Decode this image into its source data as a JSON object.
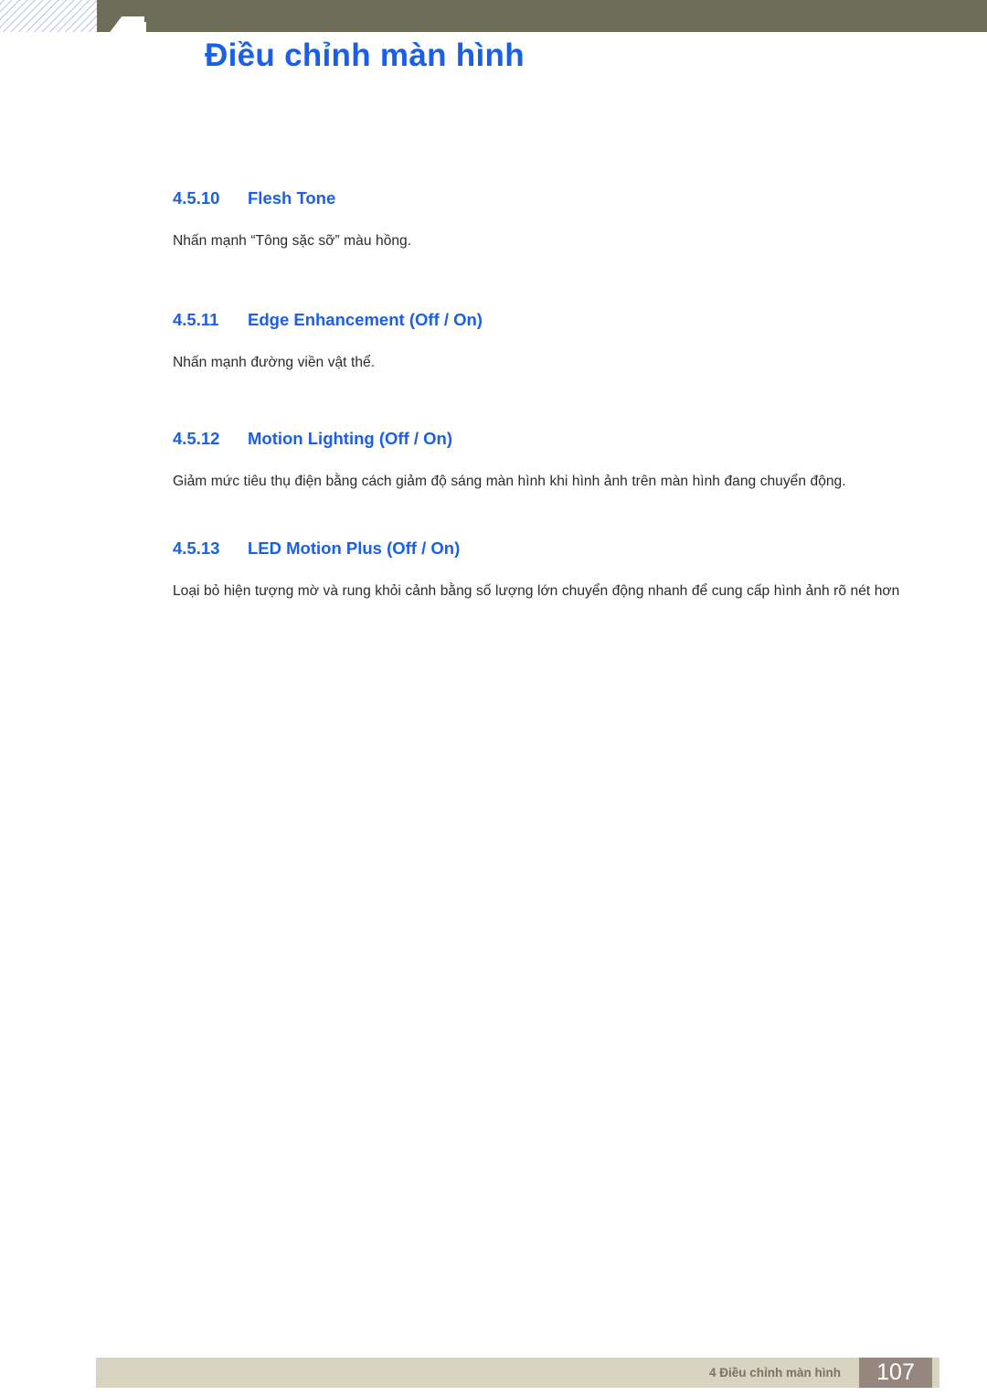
{
  "header": {
    "chapter_number": "4",
    "chapter_title": "Điều chỉnh màn hình",
    "banner_color": "#6d6d58",
    "title_color": "#1a5fe8"
  },
  "content": {
    "sections": [
      {
        "number": "4.5.10",
        "title": "Flesh Tone",
        "body": "Nhấn mạnh “Tông sặc sỡ” màu hồng."
      },
      {
        "number": "4.5.11",
        "title": "Edge Enhancement (Off / On)",
        "body": "Nhấn mạnh đường viền vật thể."
      },
      {
        "number": "4.5.12",
        "title": "Motion Lighting (Off / On)",
        "body": "Giảm mức tiêu thụ điện bằng cách giảm độ sáng màn hình khi hình ảnh trên màn hình đang chuyển động."
      },
      {
        "number": "4.5.13",
        "title": "LED Motion Plus (Off / On)",
        "body": "Loại bỏ hiện tượng mờ và rung khỏi cảnh bằng số lượng lớn chuyển động nhanh để cung cấp hình ảnh rõ nét hơn"
      }
    ]
  },
  "footer": {
    "label": "4 Điều chỉnh màn hình",
    "page_number": "107",
    "bar_color": "#d8d4c0",
    "page_box_color": "#95867e"
  }
}
